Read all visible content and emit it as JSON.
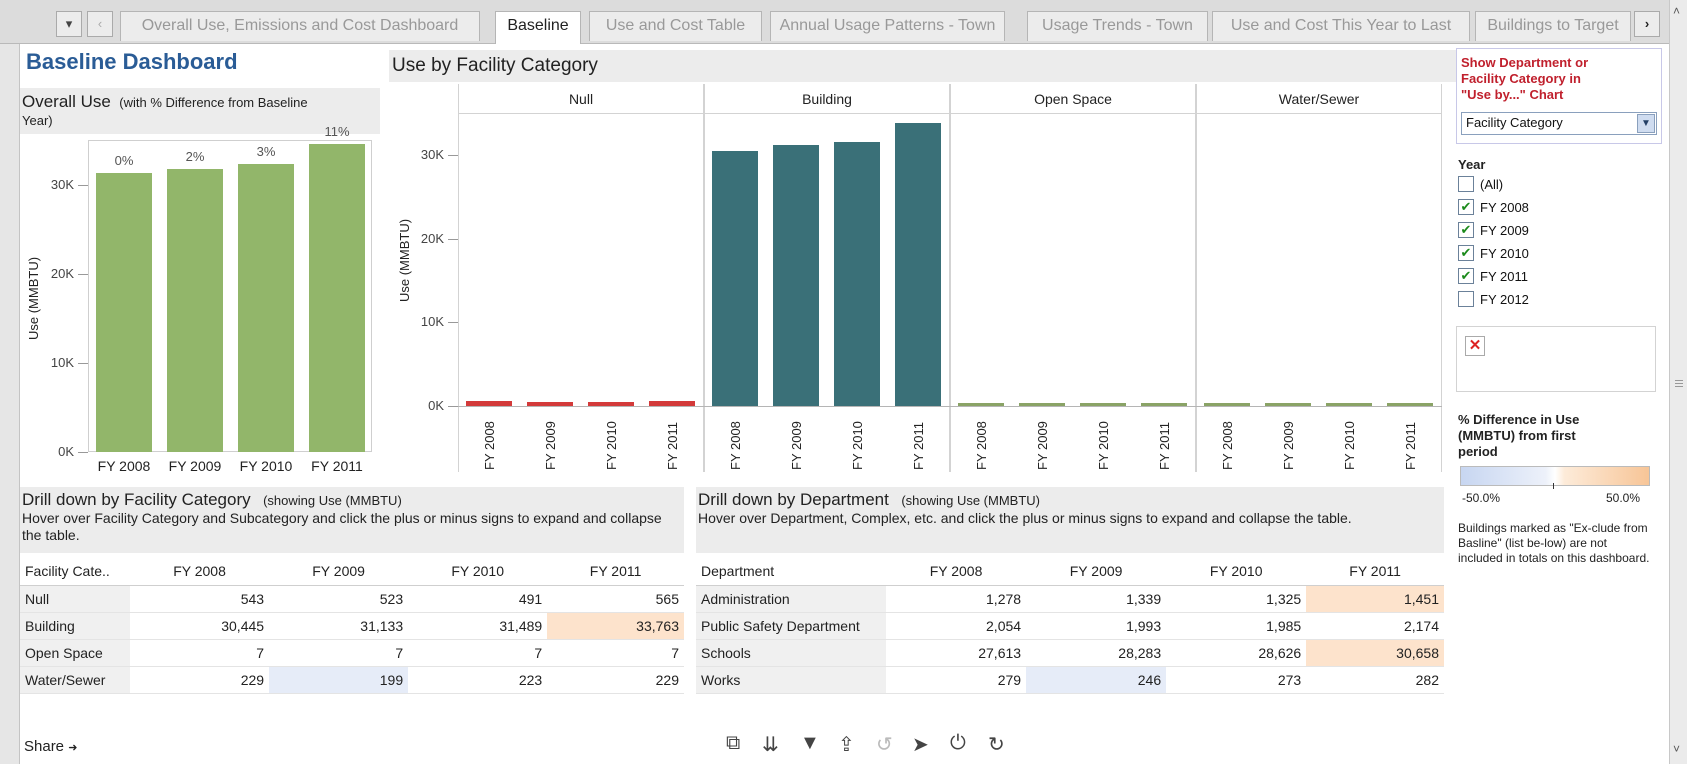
{
  "tabs": [
    "Overall Use, Emissions and Cost Dashboard",
    "Baseline",
    "Use and Cost Table",
    "Annual Usage Patterns - Town",
    "Usage Trends - Town",
    "Use and Cost This Year to Last",
    "Buildings to Target"
  ],
  "nav": {
    "menu": "▾",
    "prev": "‹",
    "next": "›"
  },
  "title": "Baseline Dashboard",
  "overall": {
    "title": "Overall Use",
    "subtitle": "(with % Difference from Baseline",
    "subtitle2": "Year)",
    "ylabel": "Use (MMBTU)"
  },
  "facility_chart": {
    "title": "Use by Facility Category",
    "ylabel": "Use (MMBTU)"
  },
  "chart_data": [
    {
      "type": "bar",
      "title": "Overall Use",
      "categories": [
        "FY 2008",
        "FY 2009",
        "FY 2010",
        "FY 2011"
      ],
      "values": [
        31250,
        31800,
        32300,
        34500
      ],
      "data_labels": [
        "0%",
        "2%",
        "3%",
        "11%"
      ],
      "ylabel": "Use (MMBTU)",
      "ylim": [
        0,
        35000
      ],
      "yticks": [
        "0K",
        "10K",
        "20K",
        "30K"
      ],
      "color": "#92b66a"
    },
    {
      "type": "bar",
      "title": "Use by Facility Category",
      "panels": [
        "Null",
        "Building",
        "Open Space",
        "Water/Sewer"
      ],
      "categories": [
        "FY 2008",
        "FY 2009",
        "FY 2010",
        "FY 2011"
      ],
      "series": [
        {
          "name": "Null",
          "values": [
            543,
            523,
            491,
            565
          ],
          "color": "#d33a3a"
        },
        {
          "name": "Building",
          "values": [
            30445,
            31133,
            31489,
            33763
          ],
          "color": "#3a7078"
        },
        {
          "name": "Open Space",
          "values": [
            7,
            7,
            7,
            7
          ],
          "color": "#8aa366"
        },
        {
          "name": "Water/Sewer",
          "values": [
            229,
            199,
            223,
            229
          ],
          "color": "#8aa366"
        }
      ],
      "ylabel": "Use (MMBTU)",
      "ylim": [
        0,
        35000
      ],
      "yticks": [
        "0K",
        "10K",
        "20K",
        "30K"
      ]
    }
  ],
  "drill_facility": {
    "title": "Drill down by Facility Category",
    "note": "(showing Use (MMBTU)",
    "help": "Hover over Facility Category and Subcategory and click the plus or minus signs to expand and collapse the table.",
    "columns": [
      "Facility Cate..",
      "FY 2008",
      "FY 2009",
      "FY 2010",
      "FY 2011"
    ],
    "rows": [
      [
        "Null",
        "543",
        "523",
        "491",
        "565"
      ],
      [
        "Building",
        "30,445",
        "31,133",
        "31,489",
        "33,763"
      ],
      [
        "Open Space",
        "7",
        "7",
        "7",
        "7"
      ],
      [
        "Water/Sewer",
        "229",
        "199",
        "223",
        "229"
      ]
    ]
  },
  "drill_dept": {
    "title": "Drill down by Department",
    "note": "(showing Use (MMBTU)",
    "help": "Hover over Department, Complex, etc. and click the plus or minus signs to expand and collapse the table.",
    "columns": [
      "Department",
      "FY 2008",
      "FY 2009",
      "FY 2010",
      "FY 2011"
    ],
    "rows": [
      [
        "Administration",
        "1,278",
        "1,339",
        "1,325",
        "1,451"
      ],
      [
        "Public Safety Department",
        "2,054",
        "1,993",
        "1,985",
        "2,174"
      ],
      [
        "Schools",
        "27,613",
        "28,283",
        "28,626",
        "30,658"
      ],
      [
        "Works",
        "279",
        "246",
        "273",
        "282"
      ]
    ]
  },
  "side": {
    "show_title": "Show Department or Facility Category in \"Use by...\" Chart",
    "select_value": "Facility Category",
    "year_title": "Year",
    "years": [
      {
        "label": "(All)",
        "checked": false
      },
      {
        "label": "FY 2008",
        "checked": true
      },
      {
        "label": "FY 2009",
        "checked": true
      },
      {
        "label": "FY 2010",
        "checked": true
      },
      {
        "label": "FY 2011",
        "checked": true
      },
      {
        "label": "FY 2012",
        "checked": false
      }
    ],
    "error_icon": "✕",
    "legend_title": "% Difference in Use (MMBTU) from first period",
    "legend_min": "-50.0%",
    "legend_max": "50.0%",
    "note": "Buildings marked as \"Ex-clude from Basline\" (list be-low) are not included in totals on this dashboard."
  },
  "footer": {
    "share": "Share",
    "share_arrow": "➜"
  },
  "toolbar_icons": [
    "zoom-icon",
    "sort-icon",
    "filter-icon",
    "export-icon",
    "undo-icon",
    "pointer-icon",
    "pause-icon",
    "refresh-icon"
  ],
  "colors": {
    "title_blue": "#2a5c96",
    "side_red": "#c0202d",
    "highlight_orange": "#fde3cc",
    "highlight_blue": "#e6ecf8"
  }
}
